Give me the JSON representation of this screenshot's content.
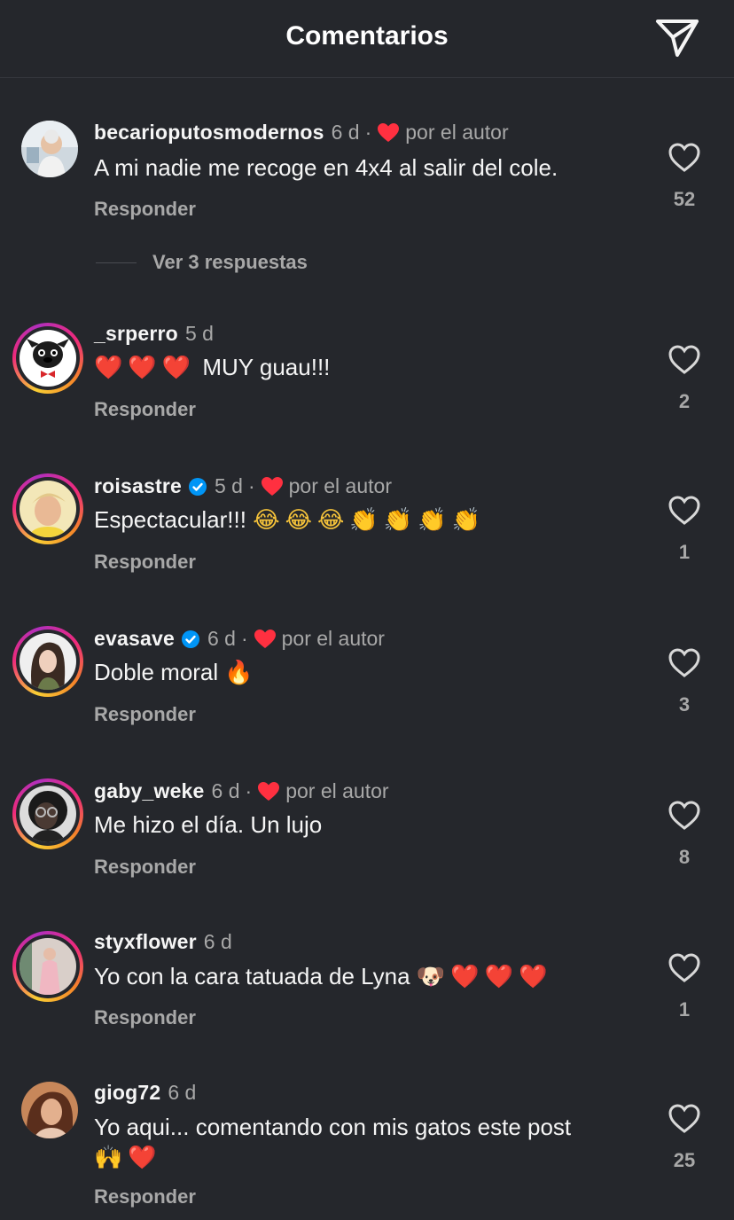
{
  "header": {
    "title": "Comentarios",
    "share_icon": "send-icon"
  },
  "view_replies": "Ver 3 respuestas",
  "reply_label": "Responder",
  "author_like_label": "por el autor",
  "comments": [
    {
      "username": "becarioputosmodernos",
      "time": "6 d",
      "verified": false,
      "author_liked": true,
      "text": "A mi nadie me recoge en 4x4 al salir del cole.",
      "likes": "52"
    },
    {
      "username": "_srperro",
      "time": "5 d",
      "verified": false,
      "author_liked": false,
      "text": "MUY guau!!!",
      "likes": "2"
    },
    {
      "username": "roisastre",
      "time": "5 d",
      "verified": true,
      "author_liked": true,
      "text": "Espectacular!!!",
      "likes": "1"
    },
    {
      "username": "evasave",
      "time": "6 d",
      "verified": true,
      "author_liked": true,
      "text": "Doble moral",
      "likes": "3"
    },
    {
      "username": "gaby_weke",
      "time": "6 d",
      "verified": false,
      "author_liked": true,
      "text": "Me hizo el día. Un lujo",
      "likes": "8"
    },
    {
      "username": "styxflower",
      "time": "6 d",
      "verified": false,
      "author_liked": false,
      "text": "Yo con la cara tatuada de Lyna",
      "likes": "1"
    },
    {
      "username": "giog72",
      "time": "6 d",
      "verified": false,
      "author_liked": false,
      "text": "Yo aqui... comentando con mis gatos este post",
      "likes": "25"
    }
  ],
  "colors": {
    "background": "#25272c",
    "heart_red": "#ff3040",
    "verified_blue": "#0095f6",
    "muted": "#a8a8a8"
  }
}
